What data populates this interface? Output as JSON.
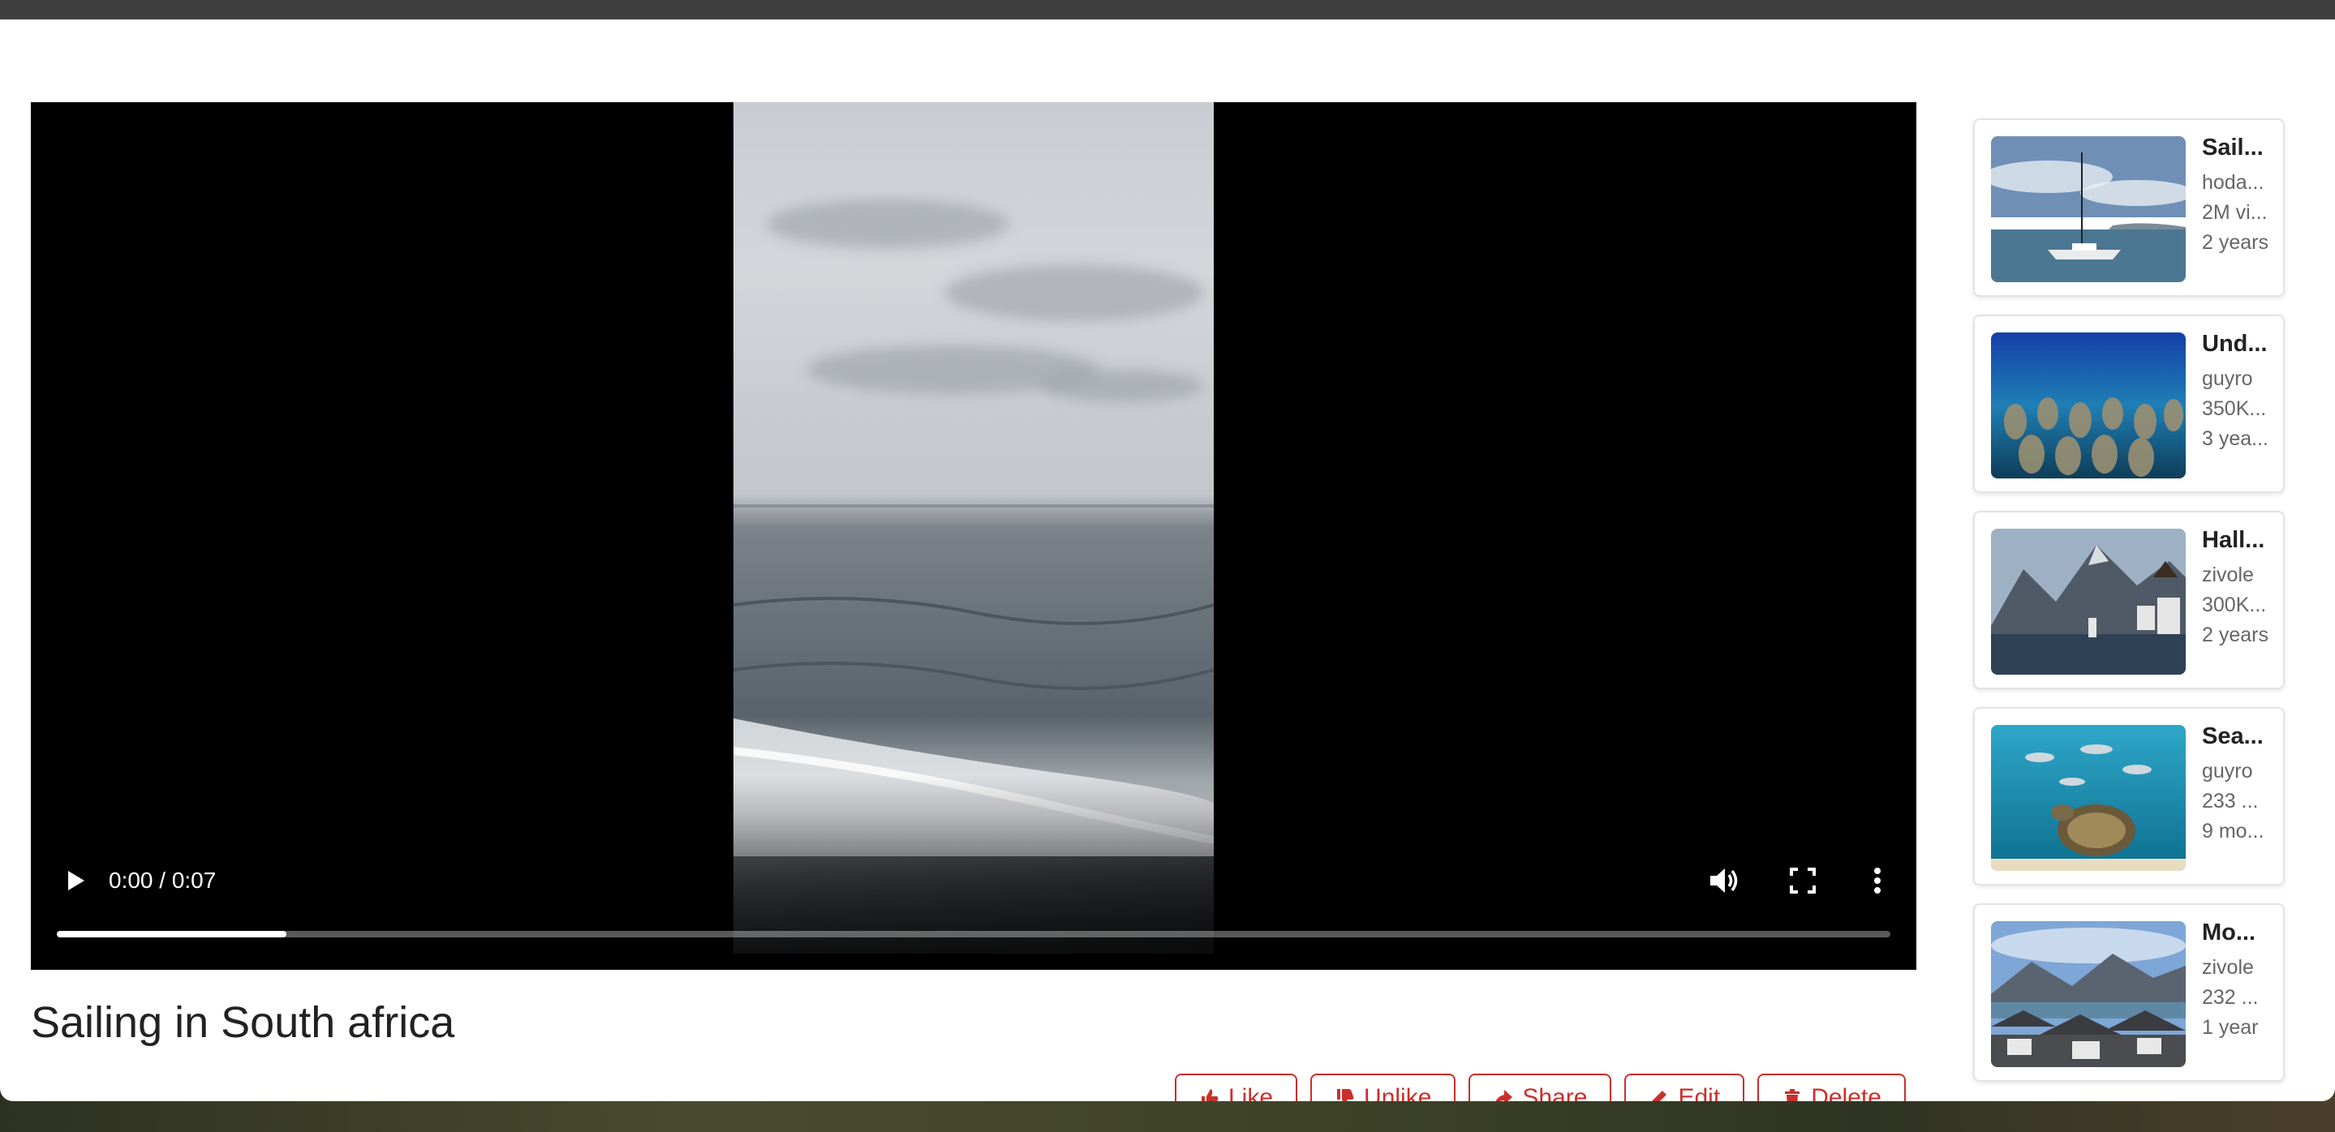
{
  "player": {
    "time": "0:00 / 0:07",
    "progress_fraction": 0.125
  },
  "video": {
    "title": "Sailing in South africa"
  },
  "actions": [
    {
      "label": "Like",
      "icon": "thumbs-up-icon"
    },
    {
      "label": "Unlike",
      "icon": "thumbs-down-icon"
    },
    {
      "label": "Share",
      "icon": "share-icon"
    },
    {
      "label": "Edit",
      "icon": "edit-icon"
    },
    {
      "label": "Delete",
      "icon": "trash-icon"
    }
  ],
  "related": [
    {
      "title": "Sail...",
      "channel": "hoda...",
      "views": "2M vi...",
      "age": "2 years"
    },
    {
      "title": "Und...",
      "channel": "guyro",
      "views": "350K...",
      "age": "3 yea..."
    },
    {
      "title": "Hall...",
      "channel": "zivole",
      "views": "300K...",
      "age": "2 years"
    },
    {
      "title": "Sea...",
      "channel": "guyro",
      "views": "233 ...",
      "age": "9 mo..."
    },
    {
      "title": "Mo...",
      "channel": "zivole",
      "views": "232 ...",
      "age": "1 year"
    }
  ],
  "colors": {
    "accent": "#c9302c",
    "topbar": "#3e3e3e"
  }
}
